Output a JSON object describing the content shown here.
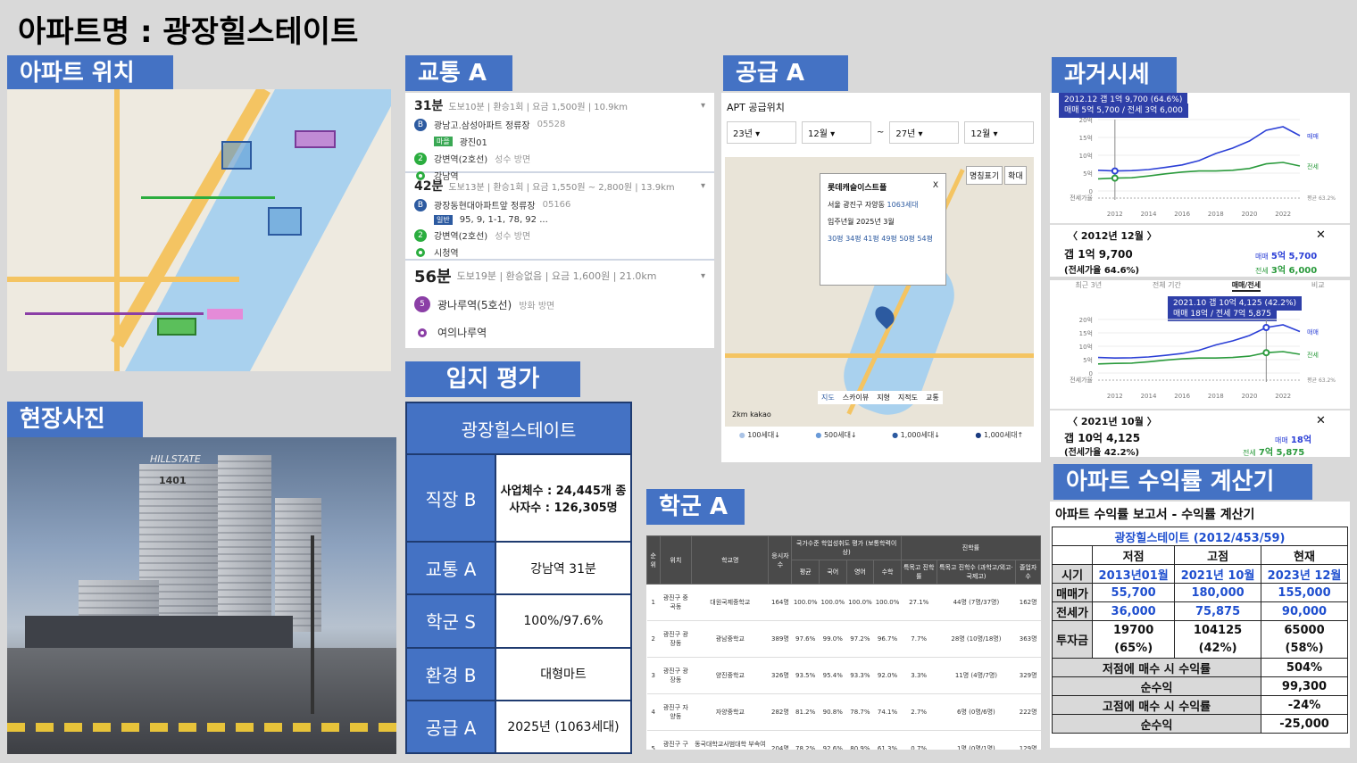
{
  "title": "아파트명 : 광장힐스테이트",
  "sections": {
    "location": "아파트 위치",
    "photo": "현장사진",
    "transit": "교통 A",
    "evaluation": "입지 평가",
    "supply": "공급 A",
    "school": "학군 A",
    "history": "과거시세",
    "calc": "아파트 수익률 계산기"
  },
  "photo": {
    "sign": "1401",
    "brand": "HILLSTATE"
  },
  "transit": {
    "routes": [
      {
        "time": "31분",
        "info": "도보10분 | 환승1회 | 요금 1,500원 | 10.9km",
        "stops": [
          {
            "name": "광남고.삼성아파트 정류장",
            "extra": "05528",
            "color": "#2c5aa0",
            "icon": "B"
          },
          {
            "name": "광진01",
            "extra": "마을",
            "color": "#fff",
            "icon": ""
          },
          {
            "name": "강변역(2호선)",
            "extra": "성수 방면",
            "color": "#2bad3f",
            "icon": "2"
          },
          {
            "name": "강남역",
            "extra": "",
            "color": "#2bad3f",
            "icon": ""
          }
        ]
      },
      {
        "time": "42분",
        "info": "도보13분 | 환승1회 | 요금 1,550원 ~ 2,800원 | 13.9km",
        "stops": [
          {
            "name": "광장동현대아파트앞 정류장",
            "extra": "05166",
            "color": "#2c5aa0",
            "icon": "B"
          },
          {
            "name": "95, 9, 1-1, 78, 92 ...",
            "extra": "일반",
            "color": "#fff",
            "icon": ""
          },
          {
            "name": "강변역(2호선)",
            "extra": "성수 방면",
            "color": "#2bad3f",
            "icon": "2"
          },
          {
            "name": "시청역",
            "extra": "",
            "color": "#2bad3f",
            "icon": ""
          }
        ]
      },
      {
        "time": "56분",
        "info": "도보19분 | 환승없음 | 요금 1,600원 | 21.0km",
        "stops": [
          {
            "name": "광나루역(5호선)",
            "extra": "방화 방면",
            "color": "#8b3fa6",
            "icon": "5"
          },
          {
            "name": "여의나루역",
            "extra": "",
            "color": "#8b3fa6",
            "icon": ""
          }
        ]
      }
    ]
  },
  "evaluation": {
    "name": "광장힐스테이트",
    "rows": [
      {
        "label": "직장 B",
        "value": "사업체수 : 24,445개 종사자수 : 126,305명"
      },
      {
        "label": "교통 A",
        "value": "강남역 31분"
      },
      {
        "label": "학군 S",
        "value": "100%/97.6%"
      },
      {
        "label": "환경 B",
        "value": "대형마트"
      },
      {
        "label": "공급 A",
        "value": "2025년 (1063세대)"
      }
    ]
  },
  "supply": {
    "header": "APT 공급위치",
    "selects": [
      "23년",
      "12월",
      "27년",
      "12월"
    ],
    "tilde": "~",
    "popup": {
      "name": "롯데캐슬이스트폴",
      "addr": "서울 광진구 자양동",
      "units": "1063세대",
      "move_in_label": "입주년월",
      "move_in": "2025년 3월",
      "sizes": "30평 34평 41평 49평 50평 54평",
      "close": "X"
    },
    "map_buttons": [
      "명칭표기",
      "확대"
    ],
    "map_tabs": [
      "지도",
      "스카이뷰",
      "지형",
      "지적도",
      "교통"
    ],
    "scale": "2km",
    "brand": "kakao",
    "legend": [
      "100세대↓",
      "500세대↓",
      "1,000세대↓",
      "1,000세대↑"
    ]
  },
  "school": {
    "headers": [
      "순위",
      "위치",
      "학교명",
      "응시자수",
      "국가수준 학업성취도 평가 (보통학력이상)",
      "평균",
      "국어",
      "영어",
      "수학",
      "진학률",
      "특목고 진학률",
      "특목고 진학수 (과학고/외고·국제고)",
      "졸업자 수"
    ],
    "rows": [
      [
        "1",
        "광진구 중곡동",
        "대원국제중학교",
        "164명",
        "100.0%",
        "100.0%",
        "100.0%",
        "100.0%",
        "27.1%",
        "44명 (7명/37명)",
        "162명"
      ],
      [
        "2",
        "광진구 광장동",
        "광남중학교",
        "389명",
        "97.6%",
        "99.0%",
        "97.2%",
        "96.7%",
        "7.7%",
        "28명 (10명/18명)",
        "363명"
      ],
      [
        "3",
        "광진구 광장동",
        "양진중학교",
        "326명",
        "93.5%",
        "95.4%",
        "93.3%",
        "92.0%",
        "3.3%",
        "11명 (4명/7명)",
        "329명"
      ],
      [
        "4",
        "광진구 자양동",
        "자양중학교",
        "282명",
        "81.2%",
        "90.8%",
        "78.7%",
        "74.1%",
        "2.7%",
        "6명 (0명/6명)",
        "222명"
      ],
      [
        "5",
        "광진구 구의동",
        "동국대학교사범대학 부속여자중학교",
        "204명",
        "78.2%",
        "92.6%",
        "80.9%",
        "61.3%",
        "0.7%",
        "1명 (0명/1명)",
        "129명"
      ]
    ]
  },
  "history": {
    "chart1": {
      "tag1": "2012.12  갭 1억 9,700 (64.6%)",
      "tag2": "매매 5억 5,700 / 전세 3억 6,000",
      "nav_date": "2012년 12월",
      "gap": "갭 1억 9,700",
      "ratio": "(전세가율 64.6%)",
      "sale_label": "매매",
      "sale": "5억 5,700",
      "rent_label": "전세",
      "rent": "3억 6,000",
      "series_labels": [
        "매매",
        "전세",
        "평균 63.2%"
      ],
      "ylabels": [
        "20억",
        "15억",
        "10억",
        "5억",
        "0",
        "전세가율"
      ],
      "xlabels": [
        "2012",
        "2014",
        "2016",
        "2018",
        "2020",
        "2022"
      ]
    },
    "chart2": {
      "tabs": [
        "최근 3년",
        "전체 기간",
        "매매/전세",
        "비교"
      ],
      "tag1": "2021.10  갭 10억 4,125 (42.2%)",
      "tag2": "매매 18억 / 전세 7억 5,875",
      "nav_date": "2021년 10월",
      "gap": "갭 10억 4,125",
      "ratio": "(전세가율 42.2%)",
      "sale_label": "매매",
      "sale": "18억",
      "rent_label": "전세",
      "rent": "7억 5,875",
      "series_labels": [
        "매매",
        "전세",
        "평균 63.2%"
      ],
      "ylabels": [
        "20억",
        "15억",
        "10억",
        "5억",
        "0",
        "전세가율"
      ],
      "xlabels": [
        "2012",
        "2014",
        "2016",
        "2018",
        "2020",
        "2022"
      ]
    }
  },
  "chart_data": [
    {
      "type": "line",
      "title": "",
      "x": [
        2011,
        2012,
        2013,
        2014,
        2015,
        2016,
        2017,
        2018,
        2019,
        2020,
        2021,
        2022,
        2023
      ],
      "series": [
        {
          "name": "매매",
          "values": [
            5.8,
            5.6,
            5.7,
            6.0,
            6.6,
            7.3,
            8.5,
            10.5,
            12.0,
            14.0,
            17.0,
            18.0,
            15.5
          ]
        },
        {
          "name": "전세",
          "values": [
            3.4,
            3.6,
            3.7,
            4.2,
            4.8,
            5.3,
            5.6,
            5.6,
            5.8,
            6.3,
            7.6,
            8.0,
            7.0
          ]
        }
      ],
      "ylim": [
        0,
        20
      ]
    }
  ],
  "calc": {
    "caption": "아파트 수익률 보고서 - 수익률 계산기",
    "subtitle": "광장힐스테이트 (2012/453/59)",
    "cols": [
      "저점",
      "고점",
      "현재"
    ],
    "rows": [
      {
        "label": "시기",
        "vals": [
          "2013년01월",
          "2021년 10월",
          "2023년 12월"
        ],
        "blue": true
      },
      {
        "label": "매매가",
        "vals": [
          "55,700",
          "180,000",
          "155,000"
        ],
        "blue": true
      },
      {
        "label": "전세가",
        "vals": [
          "36,000",
          "75,875",
          "90,000"
        ],
        "blue": true
      }
    ],
    "invest_label": "투자금",
    "invest": [
      "19700",
      "104125",
      "65000"
    ],
    "invest_pct": [
      "(65%)",
      "(42%)",
      "(58%)"
    ],
    "summary": [
      {
        "label": "저점에 매수 시 수익률",
        "val": "504%"
      },
      {
        "label": "순수익",
        "val": "99,300"
      },
      {
        "label": "고점에 매수 시 수익률",
        "val": "-24%"
      },
      {
        "label": "순수익",
        "val": "-25,000"
      }
    ]
  }
}
